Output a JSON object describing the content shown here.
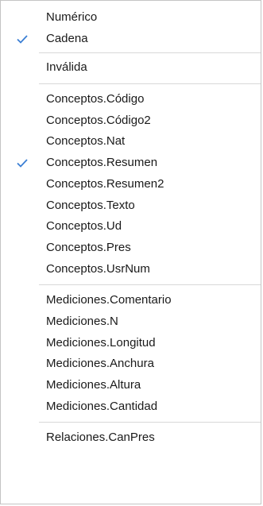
{
  "menu": {
    "check_color": "#3b7fd4",
    "groups": [
      {
        "items": [
          {
            "label": "Numérico",
            "checked": false
          },
          {
            "label": "Cadena",
            "checked": true
          }
        ]
      },
      {
        "items": [
          {
            "label": "Inválida",
            "checked": false
          }
        ]
      },
      {
        "items": [
          {
            "label": "Conceptos.Código",
            "checked": false
          },
          {
            "label": "Conceptos.Código2",
            "checked": false
          },
          {
            "label": "Conceptos.Nat",
            "checked": false
          },
          {
            "label": "Conceptos.Resumen",
            "checked": true
          },
          {
            "label": "Conceptos.Resumen2",
            "checked": false
          },
          {
            "label": "Conceptos.Texto",
            "checked": false
          },
          {
            "label": "Conceptos.Ud",
            "checked": false
          },
          {
            "label": "Conceptos.Pres",
            "checked": false
          },
          {
            "label": "Conceptos.UsrNum",
            "checked": false
          }
        ]
      },
      {
        "items": [
          {
            "label": "Mediciones.Comentario",
            "checked": false
          },
          {
            "label": "Mediciones.N",
            "checked": false
          },
          {
            "label": "Mediciones.Longitud",
            "checked": false
          },
          {
            "label": "Mediciones.Anchura",
            "checked": false
          },
          {
            "label": "Mediciones.Altura",
            "checked": false
          },
          {
            "label": "Mediciones.Cantidad",
            "checked": false
          }
        ]
      },
      {
        "items": [
          {
            "label": "Relaciones.CanPres",
            "checked": false
          }
        ]
      }
    ]
  }
}
